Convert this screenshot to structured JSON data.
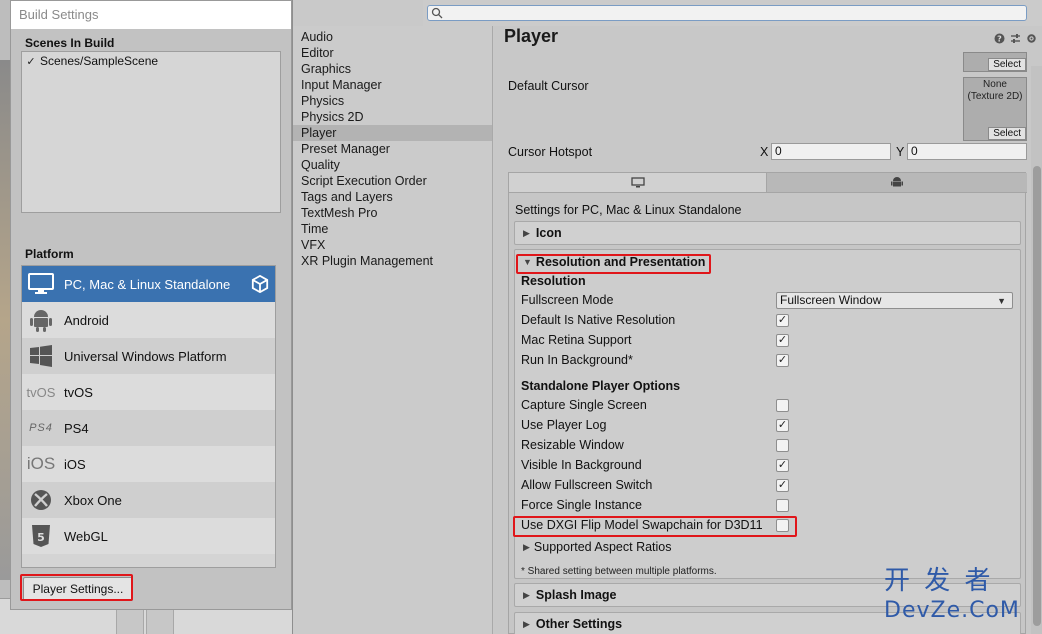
{
  "build_window": {
    "title": "Build Settings",
    "scenes_label": "Scenes In Build",
    "scenes": [
      {
        "name": "Scenes/SampleScene",
        "checked": true
      }
    ],
    "platform_label": "Platform",
    "platforms": [
      {
        "name": "PC, Mac & Linux Standalone",
        "icon": "monitor-icon",
        "selected": true
      },
      {
        "name": "Android",
        "icon": "android-icon",
        "selected": false
      },
      {
        "name": "Universal Windows Platform",
        "icon": "windows-icon",
        "selected": false
      },
      {
        "name": "tvOS",
        "icon": "tvos-icon",
        "icon_text": "tvOS",
        "selected": false
      },
      {
        "name": "PS4",
        "icon": "ps4-icon",
        "icon_text": "PS4",
        "selected": false
      },
      {
        "name": "iOS",
        "icon": "ios-icon",
        "icon_text": "iOS",
        "selected": false
      },
      {
        "name": "Xbox One",
        "icon": "xbox-icon",
        "selected": false
      },
      {
        "name": "WebGL",
        "icon": "html5-icon",
        "selected": false
      }
    ],
    "player_settings_button": "Player Settings..."
  },
  "project_window": {
    "nav_items": [
      "Audio",
      "Editor",
      "Graphics",
      "Input Manager",
      "Physics",
      "Physics 2D",
      "Player",
      "Preset Manager",
      "Quality",
      "Script Execution Order",
      "Tags and Layers",
      "TextMesh Pro",
      "Time",
      "VFX",
      "XR Plugin Management"
    ],
    "active_nav": "Player",
    "page_title": "Player",
    "select_label": "Select",
    "default_cursor_label": "Default Cursor",
    "cursor_texture": "None (Texture 2D)",
    "cursor_hotspot_label": "Cursor Hotspot",
    "hotspot_x_label": "X",
    "hotspot_x": "0",
    "hotspot_y_label": "Y",
    "hotspot_y": "0",
    "settings_for": "Settings for PC, Mac & Linux Standalone",
    "icon_section": "Icon",
    "resolution_section": "Resolution and Presentation",
    "resolution_header": "Resolution",
    "fullscreen_mode_label": "Fullscreen Mode",
    "fullscreen_mode_value": "Fullscreen Window",
    "resolution_options": [
      {
        "label": "Default Is Native Resolution",
        "checked": true
      },
      {
        "label": "Mac Retina Support",
        "checked": true
      },
      {
        "label": "Run In Background*",
        "checked": true
      }
    ],
    "standalone_header": "Standalone Player Options",
    "standalone_options": [
      {
        "label": "Capture Single Screen",
        "checked": false
      },
      {
        "label": "Use Player Log",
        "checked": true
      },
      {
        "label": "Resizable Window",
        "checked": false
      },
      {
        "label": "Visible In Background",
        "checked": true
      },
      {
        "label": "Allow Fullscreen Switch",
        "checked": true
      },
      {
        "label": "Force Single Instance",
        "checked": false
      },
      {
        "label": "Use DXGI Flip Model Swapchain for D3D11",
        "checked": false
      }
    ],
    "aspect_ratios": "Supported Aspect Ratios",
    "footnote": "* Shared setting between multiple platforms.",
    "splash_section": "Splash Image",
    "other_section": "Other Settings"
  },
  "watermark": {
    "line1": "开 发 者",
    "line2": "DevZe.CoM"
  },
  "colors": {
    "selection": "#3a72b0",
    "highlight_box": "#e0161a",
    "watermark": "#2f5aa8"
  }
}
